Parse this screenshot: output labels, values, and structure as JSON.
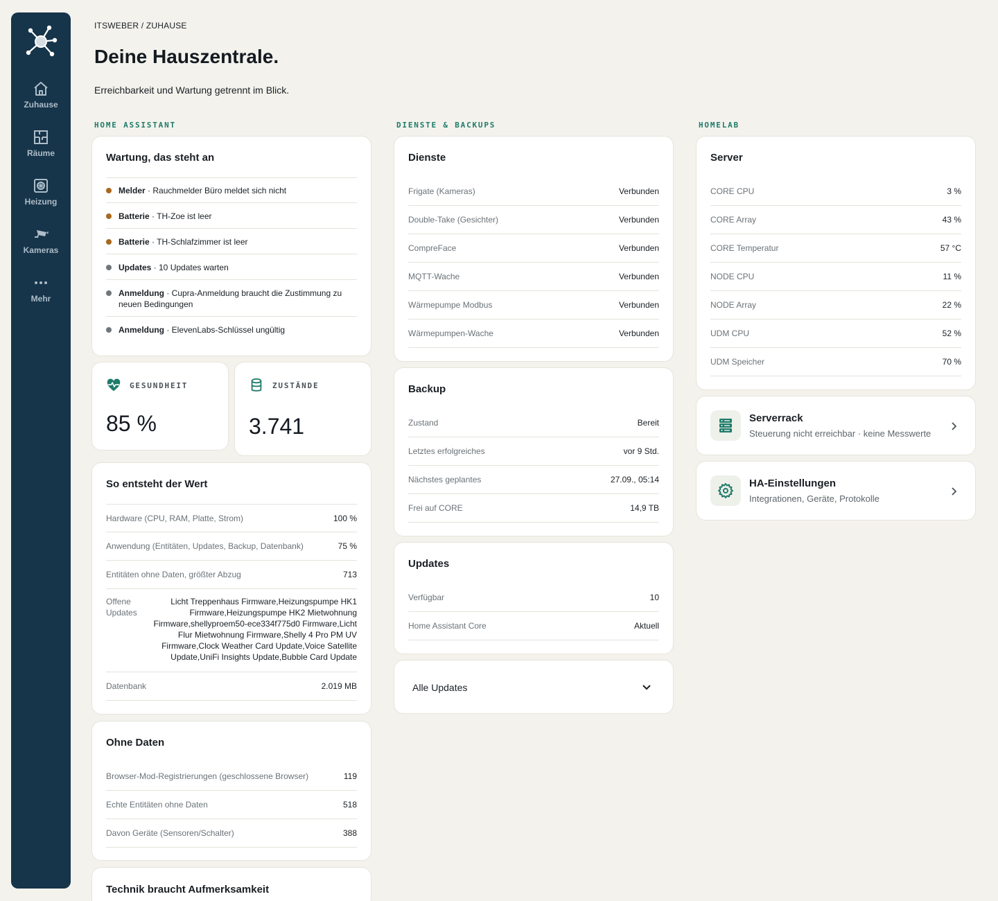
{
  "sidebar": {
    "items": [
      {
        "label": "Zuhause",
        "icon": "home-icon"
      },
      {
        "label": "Räume",
        "icon": "floorplan-icon"
      },
      {
        "label": "Heizung",
        "icon": "heating-icon"
      },
      {
        "label": "Kameras",
        "icon": "camera-icon"
      },
      {
        "label": "Mehr",
        "icon": "dots-icon"
      }
    ]
  },
  "header": {
    "breadcrumb": "ITSWEBER / ZUHAUSE",
    "title": "Deine Hauszentrale.",
    "subtitle": "Erreichbarkeit und Wartung getrennt im Blick."
  },
  "columns": {
    "ha": "HOME ASSISTANT",
    "services": "DIENSTE & BACKUPS",
    "homelab": "HOMELAB"
  },
  "maintenance": {
    "title": "Wartung, das steht an",
    "items": [
      {
        "tag": "Melder",
        "text": " · Rauchmelder Büro meldet sich nicht",
        "color": "#a8681d"
      },
      {
        "tag": "Batterie",
        "text": " · TH-Zoe ist leer",
        "color": "#a8681d"
      },
      {
        "tag": "Batterie",
        "text": " · TH-Schlafzimmer ist leer",
        "color": "#a8681d"
      },
      {
        "tag": "Updates",
        "text": " · 10 Updates warten",
        "color": "#70767a"
      },
      {
        "tag": "Anmeldung",
        "text": " · Cupra-Anmeldung braucht die Zustimmung zu neuen Bedingungen",
        "color": "#70767a"
      },
      {
        "tag": "Anmeldung",
        "text": " · ElevenLabs-Schlüssel ungültig",
        "color": "#70767a"
      }
    ]
  },
  "stats": {
    "health": {
      "label": "GESUNDHEIT",
      "value": "85 %"
    },
    "states": {
      "label": "ZUSTÄNDE",
      "value": "3.741"
    }
  },
  "value_origin": {
    "title": "So entsteht der Wert",
    "rows": [
      {
        "k": "Hardware (CPU, RAM, Platte, Strom)",
        "v": "100 %"
      },
      {
        "k": "Anwendung (Entitäten, Updates, Backup, Datenbank)",
        "v": "75 %"
      },
      {
        "k": "Entitäten ohne Daten, größter Abzug",
        "v": "713"
      }
    ],
    "open_updates_label": "Offene Updates",
    "open_updates_value": "Licht Treppenhaus Firmware,Heizungspumpe HK1 Firmware,Heizungspumpe HK2 Mietwohnung Firmware,shellyproem50-ece334f775d0 Firmware,Licht Flur Mietwohnung Firmware,Shelly 4 Pro PM UV Firmware,Clock Weather Card Update,Voice Satellite Update,UniFi Insights Update,Bubble Card Update",
    "db_label": "Datenbank",
    "db_value": "2.019 MB"
  },
  "no_data": {
    "title": "Ohne Daten",
    "rows": [
      {
        "k": "Browser-Mod-Registrierungen (geschlossene Browser)",
        "v": "119"
      },
      {
        "k": "Echte Entitäten ohne Daten",
        "v": "518"
      },
      {
        "k": "Davon Geräte (Sensoren/Schalter)",
        "v": "388"
      }
    ]
  },
  "attention": {
    "title": "Technik braucht Aufmerksamkeit"
  },
  "services": {
    "title": "Dienste",
    "rows": [
      {
        "k": "Frigate (Kameras)",
        "v": "Verbunden"
      },
      {
        "k": "Double-Take (Gesichter)",
        "v": "Verbunden"
      },
      {
        "k": "CompreFace",
        "v": "Verbunden"
      },
      {
        "k": "MQTT-Wache",
        "v": "Verbunden"
      },
      {
        "k": "Wärmepumpe Modbus",
        "v": "Verbunden"
      },
      {
        "k": "Wärmepumpen-Wache",
        "v": "Verbunden"
      }
    ]
  },
  "backup": {
    "title": "Backup",
    "rows": [
      {
        "k": "Zustand",
        "v": "Bereit"
      },
      {
        "k": "Letztes erfolgreiches",
        "v": "vor 9 Std."
      },
      {
        "k": "Nächstes geplantes",
        "v": "27.09., 05:14"
      },
      {
        "k": "Frei auf CORE",
        "v": "14,9 TB"
      }
    ]
  },
  "updates": {
    "title": "Updates",
    "rows": [
      {
        "k": "Verfügbar",
        "v": "10"
      },
      {
        "k": "Home Assistant Core",
        "v": "Aktuell"
      }
    ],
    "all_label": "Alle Updates"
  },
  "server": {
    "title": "Server",
    "rows": [
      {
        "k": "CORE CPU",
        "v": "3 %"
      },
      {
        "k": "CORE Array",
        "v": "43 %"
      },
      {
        "k": "CORE Temperatur",
        "v": "57 °C"
      },
      {
        "k": "NODE CPU",
        "v": "11 %"
      },
      {
        "k": "NODE Array",
        "v": "22 %"
      },
      {
        "k": "UDM CPU",
        "v": "52 %"
      },
      {
        "k": "UDM Speicher",
        "v": "70 %"
      }
    ]
  },
  "serverrack": {
    "title": "Serverrack",
    "subtitle": "Steuerung nicht erreichbar · keine Messwerte",
    "icon": "server-icon"
  },
  "ha_settings": {
    "title": "HA-Einstellungen",
    "subtitle": "Integrationen, Geräte, Protokolle",
    "icon": "gear-icon"
  },
  "colors": {
    "sidebar": "#16344a",
    "accent": "#1f7b6a",
    "warning_dot": "#a8681d",
    "muted_dot": "#70767a",
    "background": "#f3f2ec"
  }
}
